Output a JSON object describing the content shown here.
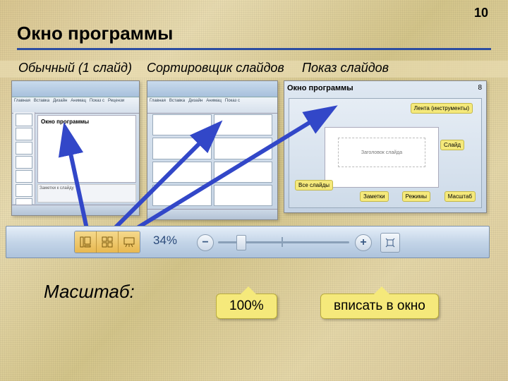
{
  "page_number": "10",
  "title": "Окно программы",
  "view_labels": {
    "normal": "Обычный (1 слайд)",
    "sorter": "Сортировщик слайдов",
    "show": "Показ слайдов"
  },
  "screenshot_a": {
    "inner_title": "Окно программы",
    "notes": "Заметки к слайду"
  },
  "screenshot_c": {
    "title": "Окно программы",
    "page_num": "8",
    "callouts": {
      "ribbon": "Лента (инструменты)",
      "slide": "Слайд",
      "all_slides": "Все слайды",
      "notes": "Заметки",
      "modes": "Режимы",
      "zoom": "Масштаб"
    },
    "placeholder": "Заголовок слайда"
  },
  "statusbar": {
    "zoom_value": "34%"
  },
  "scale_label": "Масштаб:",
  "bubbles": {
    "hundred": "100%",
    "fit": "вписать в окно"
  }
}
